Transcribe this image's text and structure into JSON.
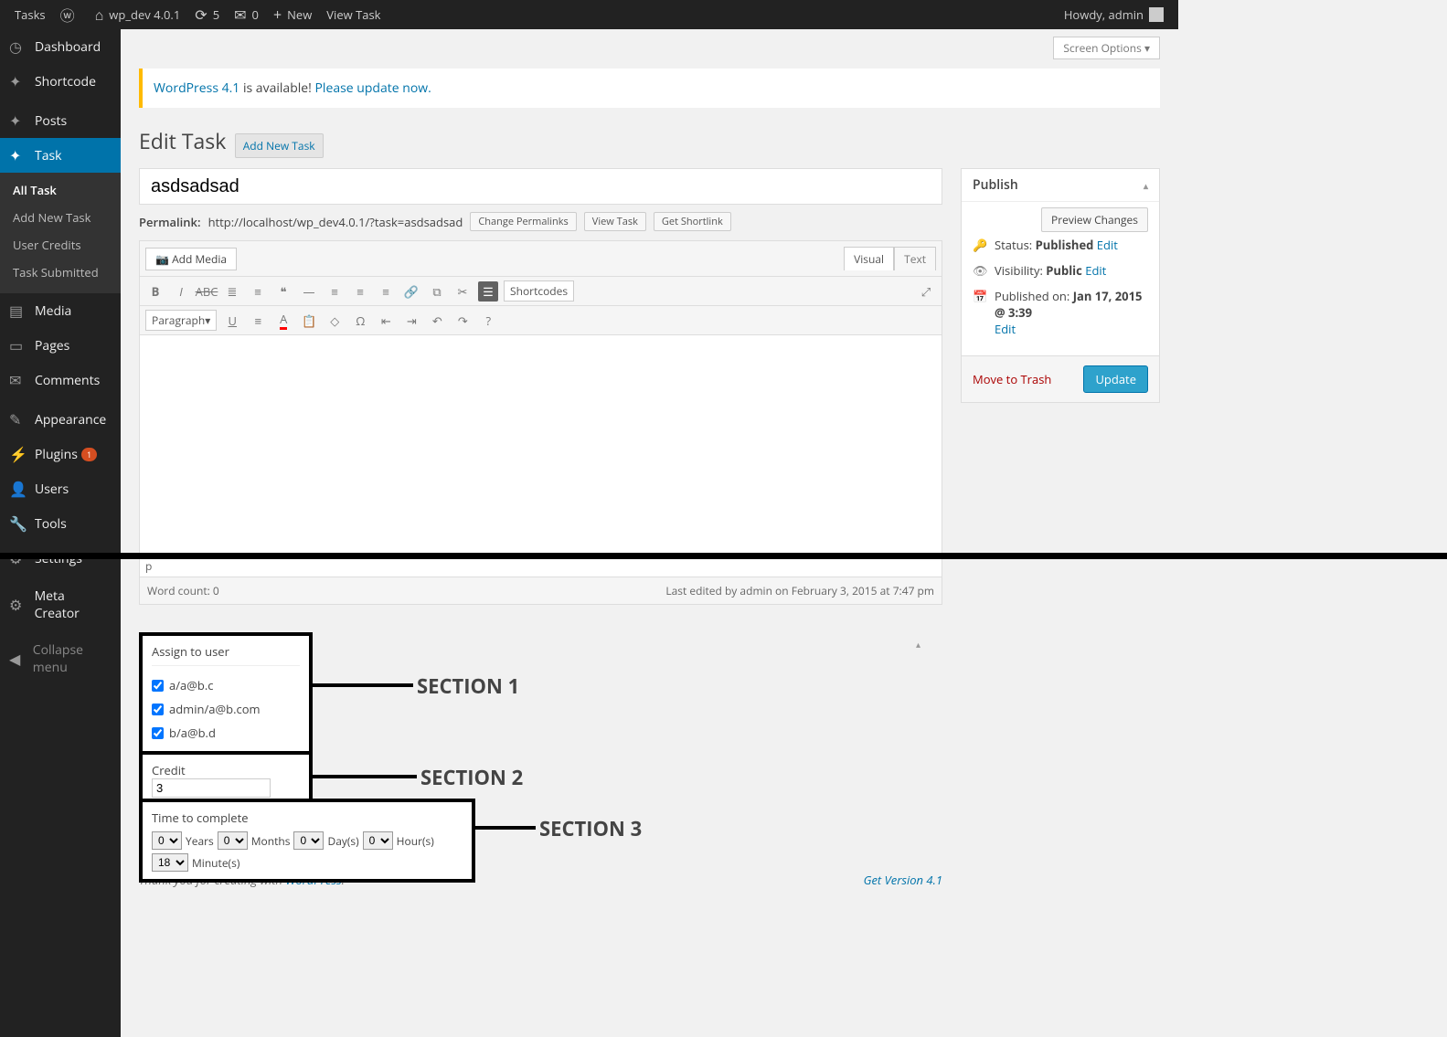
{
  "adminbar": {
    "tasks": "Tasks",
    "site": "wp_dev 4.0.1",
    "updates": "5",
    "comments": "0",
    "new": "New",
    "viewtask": "View Task",
    "howdy": "Howdy, admin"
  },
  "sidebar": {
    "dashboard": "Dashboard",
    "shortcode": "Shortcode",
    "posts": "Posts",
    "task": "Task",
    "task_sub": {
      "all": "All Task",
      "add": "Add New Task",
      "credits": "User Credits",
      "submitted": "Task Submitted"
    },
    "media": "Media",
    "pages": "Pages",
    "comments": "Comments",
    "appearance": "Appearance",
    "plugins": "Plugins",
    "plugins_badge": "1",
    "users": "Users",
    "tools": "Tools",
    "settings": "Settings",
    "meta": "Meta Creator",
    "collapse": "Collapse menu"
  },
  "screen_options": "Screen Options ▾",
  "nag": {
    "a": "WordPress 4.1",
    "b": " is available! ",
    "c": "Please update now."
  },
  "page": {
    "title": "Edit Task",
    "addnew": "Add New Task"
  },
  "post": {
    "title": "asdsadsad",
    "permalink_label": "Permalink:",
    "permalink_url": "http://localhost/wp_dev4.0.1/?task=asdsadsad",
    "btn_change": "Change Permalinks",
    "btn_view": "View Task",
    "btn_short": "Get Shortlink"
  },
  "editor": {
    "addmedia": "Add Media",
    "tab_visual": "Visual",
    "tab_text": "Text",
    "paragraph": "Paragraph",
    "shortcodes": "Shortcodes",
    "status_p": "p",
    "wordcount": "Word count: 0",
    "lastedit": "Last edited by admin on February 3, 2015 at 7:47 pm"
  },
  "publish": {
    "heading": "Publish",
    "preview": "Preview Changes",
    "status_lbl": "Status:",
    "status_val": "Published",
    "edit": "Edit",
    "vis_lbl": "Visibility:",
    "vis_val": "Public",
    "pub_lbl": "Published on:",
    "pub_val": "Jan 17, 2015 @ 3:39",
    "trash": "Move to Trash",
    "update": "Update"
  },
  "assign": {
    "heading": "Assign to user",
    "u1": "a/a@b.c",
    "u2": "admin/a@b.com",
    "u3": "b/a@b.d"
  },
  "section1": "SECTION 1",
  "credit": {
    "heading": "Credit",
    "value": "3"
  },
  "section2": "SECTION 2",
  "time": {
    "heading": "Time to complete",
    "years_v": "0",
    "years_l": "Years",
    "months_v": "0",
    "months_l": "Months",
    "days_v": "0",
    "days_l": "Day(s)",
    "hours_v": "0",
    "hours_l": "Hour(s)",
    "mins_v": "18",
    "mins_l": "Minute(s)"
  },
  "section3": "SECTION 3",
  "footer": {
    "thank": "Thank you for creating with ",
    "wp": "WordPress",
    "dot": ".",
    "ver": "Get Version 4.1"
  }
}
